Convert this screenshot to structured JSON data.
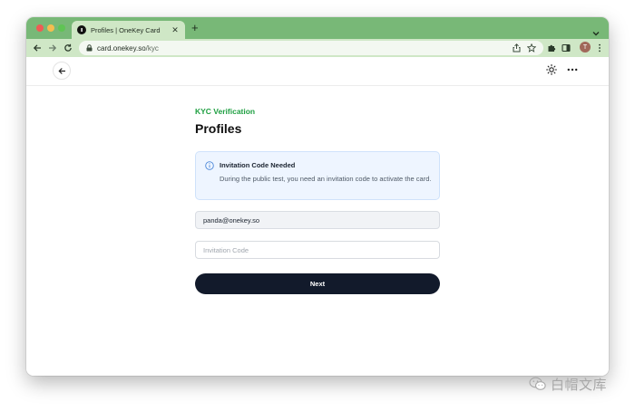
{
  "browser": {
    "tab_title": "Profiles | OneKey Card",
    "new_tab_label": "+",
    "url_host": "card.onekey.so",
    "url_path": "/kyc",
    "profile_initial": "T"
  },
  "page": {
    "eyebrow": "KYC Verification",
    "title": "Profiles",
    "notice": {
      "title": "Invitation Code Needed",
      "text": "During the public test, you need an invitation code to activate the card."
    },
    "email_value": "panda@onekey.so",
    "code_placeholder": "Invitation Code",
    "next_label": "Next"
  },
  "watermark": {
    "text": "白帽文库"
  },
  "colors": {
    "accent_green": "#1e9f41",
    "button_dark": "#121a2b",
    "notice_bg": "#eef5ff",
    "titlebar_green": "#78b877"
  }
}
